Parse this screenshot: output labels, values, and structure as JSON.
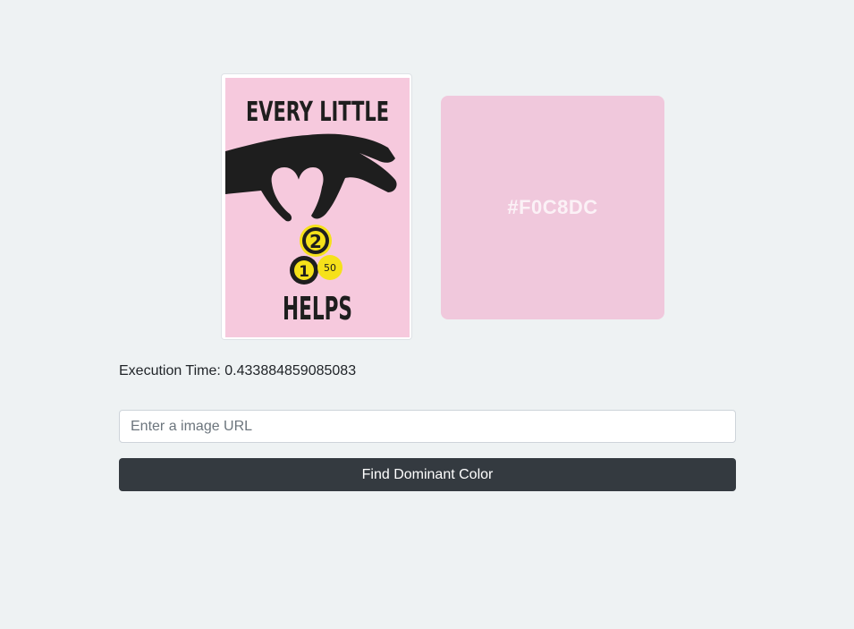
{
  "poster": {
    "line1": "EVERY LITTLE",
    "line2": "HELPS",
    "coin_large": "2",
    "coin_medium": "1",
    "coin_small": "50",
    "background": "#F6C9DD"
  },
  "result": {
    "color_hex": "#F0C8DC",
    "label": "#F0C8DC"
  },
  "execution": {
    "text": "Execution Time: 0.433884859085083"
  },
  "form": {
    "url_placeholder": "Enter a image URL",
    "url_value": "",
    "submit_label": "Find Dominant Color"
  }
}
